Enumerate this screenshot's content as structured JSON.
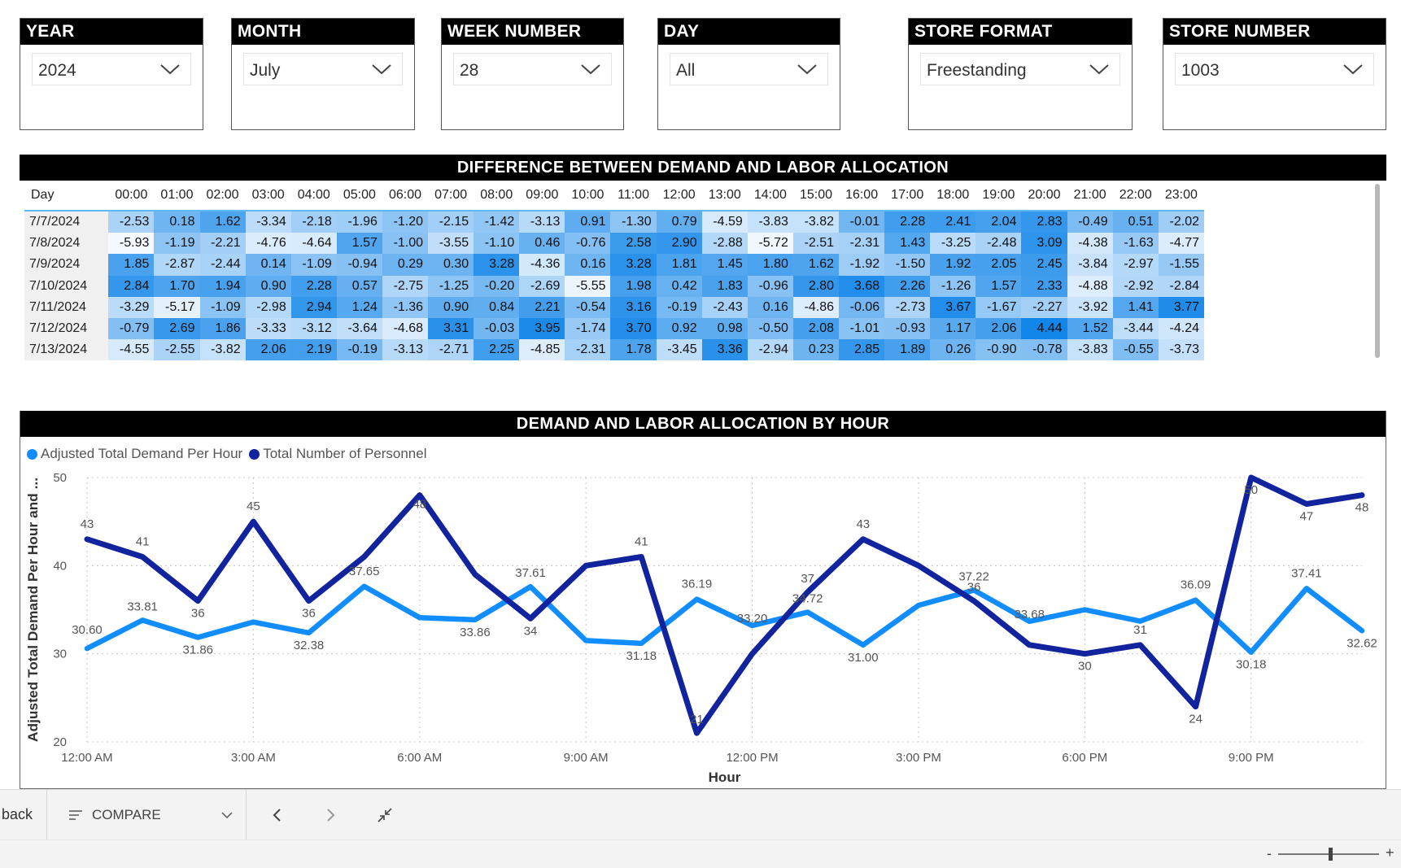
{
  "slicers": [
    {
      "id": "year",
      "label": "YEAR",
      "value": "2024"
    },
    {
      "id": "month",
      "label": "MONTH",
      "value": "July"
    },
    {
      "id": "week",
      "label": "WEEK NUMBER",
      "value": "28"
    },
    {
      "id": "day",
      "label": "DAY",
      "value": "All"
    },
    {
      "id": "store-format",
      "label": "STORE FORMAT",
      "value": "Freestanding"
    },
    {
      "id": "store-number",
      "label": "STORE NUMBER",
      "value": "1003"
    }
  ],
  "heatmap": {
    "title": "DIFFERENCE BETWEEN DEMAND AND LABOR ALLOCATION",
    "day_header": "Day",
    "hours": [
      "00:00",
      "01:00",
      "02:00",
      "03:00",
      "04:00",
      "05:00",
      "06:00",
      "07:00",
      "08:00",
      "09:00",
      "10:00",
      "11:00",
      "12:00",
      "13:00",
      "14:00",
      "15:00",
      "16:00",
      "17:00",
      "18:00",
      "19:00",
      "20:00",
      "21:00",
      "22:00",
      "23:00"
    ],
    "rows": [
      {
        "day": "7/7/2024",
        "values": [
          "-2.53",
          "0.18",
          "1.62",
          "-3.34",
          "-2.18",
          "-1.96",
          "-1.20",
          "-2.15",
          "-1.42",
          "-3.13",
          "0.91",
          "-1.30",
          "0.79",
          "-4.59",
          "-3.83",
          "-3.82",
          "-0.01",
          "2.28",
          "2.41",
          "2.04",
          "2.83",
          "-0.49",
          "0.51",
          "-2.02"
        ]
      },
      {
        "day": "7/8/2024",
        "values": [
          "-5.93",
          "-1.19",
          "-2.21",
          "-4.76",
          "-4.64",
          "1.57",
          "-1.00",
          "-3.55",
          "-1.10",
          "0.46",
          "-0.76",
          "2.58",
          "2.90",
          "-2.88",
          "-5.72",
          "-2.51",
          "-2.31",
          "1.43",
          "-3.25",
          "-2.48",
          "3.09",
          "-4.38",
          "-1.63",
          "-4.77"
        ]
      },
      {
        "day": "7/9/2024",
        "values": [
          "1.85",
          "-2.87",
          "-2.44",
          "0.14",
          "-1.09",
          "-0.94",
          "0.29",
          "0.30",
          "3.28",
          "-4.36",
          "0.16",
          "3.28",
          "1.81",
          "1.45",
          "1.80",
          "1.62",
          "-1.92",
          "-1.50",
          "1.92",
          "2.05",
          "2.45",
          "-3.84",
          "-2.97",
          "-1.55"
        ]
      },
      {
        "day": "7/10/2024",
        "values": [
          "2.84",
          "1.70",
          "1.94",
          "0.90",
          "2.28",
          "0.57",
          "-2.75",
          "-1.25",
          "-0.20",
          "-2.69",
          "-5.55",
          "1.98",
          "0.42",
          "1.83",
          "-0.96",
          "2.80",
          "3.68",
          "2.26",
          "-1.26",
          "1.57",
          "2.33",
          "-4.88",
          "-2.92",
          "-2.84"
        ]
      },
      {
        "day": "7/11/2024",
        "values": [
          "-3.29",
          "-5.17",
          "-1.09",
          "-2.98",
          "2.94",
          "1.24",
          "-1.36",
          "0.90",
          "0.84",
          "2.21",
          "-0.54",
          "3.16",
          "-0.19",
          "-2.43",
          "0.16",
          "-4.86",
          "-0.06",
          "-2.73",
          "3.67",
          "-1.67",
          "-2.27",
          "-3.92",
          "1.41",
          "3.77"
        ]
      },
      {
        "day": "7/12/2024",
        "values": [
          "-0.79",
          "2.69",
          "1.86",
          "-3.33",
          "-3.12",
          "-3.64",
          "-4.68",
          "3.31",
          "-0.03",
          "3.95",
          "-1.74",
          "3.70",
          "0.92",
          "0.98",
          "-0.50",
          "2.08",
          "-1.01",
          "-0.93",
          "1.17",
          "2.06",
          "4.44",
          "1.52",
          "-3.44",
          "-4.24"
        ]
      },
      {
        "day": "7/13/2024",
        "values": [
          "-4.55",
          "-2.55",
          "-3.82",
          "2.06",
          "2.19",
          "-0.19",
          "-3.13",
          "-2.71",
          "2.25",
          "-4.85",
          "-2.31",
          "1.78",
          "-3.45",
          "3.36",
          "-2.94",
          "0.23",
          "2.85",
          "1.89",
          "0.26",
          "-0.90",
          "-0.78",
          "-3.83",
          "-0.55",
          "-3.73"
        ]
      }
    ]
  },
  "line_panel": {
    "title": "DEMAND AND LABOR ALLOCATION BY HOUR",
    "legend": [
      {
        "name": "Adjusted Total Demand Per Hour",
        "color": "#118dff"
      },
      {
        "name": "Total Number of Personnel",
        "color": "#12239e"
      }
    ]
  },
  "chart_data": {
    "type": "line",
    "title": "DEMAND AND LABOR ALLOCATION BY HOUR",
    "xlabel": "Hour",
    "ylabel": "Adjusted Total Demand Per Hour and ...",
    "ylim": [
      20,
      50
    ],
    "yticks": [
      20,
      30,
      40,
      50
    ],
    "x": [
      0,
      1,
      2,
      3,
      4,
      5,
      6,
      7,
      8,
      9,
      10,
      11,
      12,
      13,
      14,
      15,
      16,
      17,
      18,
      19,
      20,
      21,
      22,
      23
    ],
    "xtick_labels": [
      {
        "x": 0,
        "label": "12:00 AM"
      },
      {
        "x": 3,
        "label": "3:00 AM"
      },
      {
        "x": 6,
        "label": "6:00 AM"
      },
      {
        "x": 9,
        "label": "9:00 AM"
      },
      {
        "x": 12,
        "label": "12:00 PM"
      },
      {
        "x": 15,
        "label": "3:00 PM"
      },
      {
        "x": 18,
        "label": "6:00 PM"
      },
      {
        "x": 21,
        "label": "9:00 PM"
      }
    ],
    "grid": true,
    "legend_position": "top-left",
    "series": [
      {
        "name": "Adjusted Total Demand Per Hour",
        "color": "#118dff",
        "values": [
          30.6,
          33.81,
          31.86,
          33.6,
          32.38,
          37.65,
          34.1,
          33.86,
          37.61,
          31.5,
          31.18,
          36.19,
          33.2,
          34.72,
          31.0,
          35.5,
          37.22,
          33.68,
          35.0,
          33.7,
          36.09,
          30.18,
          37.41,
          32.62
        ],
        "labels": [
          "30.60",
          "33.81",
          "31.86",
          "",
          "32.38",
          "37.65",
          "",
          "33.86",
          "37.61",
          "",
          "31.18",
          "36.19",
          "33.20",
          "34.72",
          "31.00",
          "",
          "37.22",
          "33.68",
          "",
          "",
          "36.09",
          "30.18",
          "37.41",
          "32.62"
        ]
      },
      {
        "name": "Total Number of Personnel",
        "color": "#12239e",
        "values": [
          43,
          41,
          36,
          45,
          36,
          41,
          48,
          39,
          34,
          40,
          41,
          21,
          30,
          37,
          43,
          40,
          36,
          31,
          30,
          31,
          24,
          50,
          47,
          48
        ],
        "labels": [
          "43",
          "41",
          "36",
          "45",
          "36",
          "",
          "48",
          "",
          "34",
          "",
          "41",
          "21",
          "",
          "37",
          "43",
          "",
          "36",
          "",
          "30",
          "31",
          "24",
          "50",
          "47",
          "48"
        ]
      }
    ]
  },
  "toolbar": {
    "back_label": "back",
    "compare_label": "COMPARE"
  },
  "statusbar": {
    "zoom_minus": "-",
    "zoom_plus": "+",
    "zoom_fraction": 0.52
  }
}
